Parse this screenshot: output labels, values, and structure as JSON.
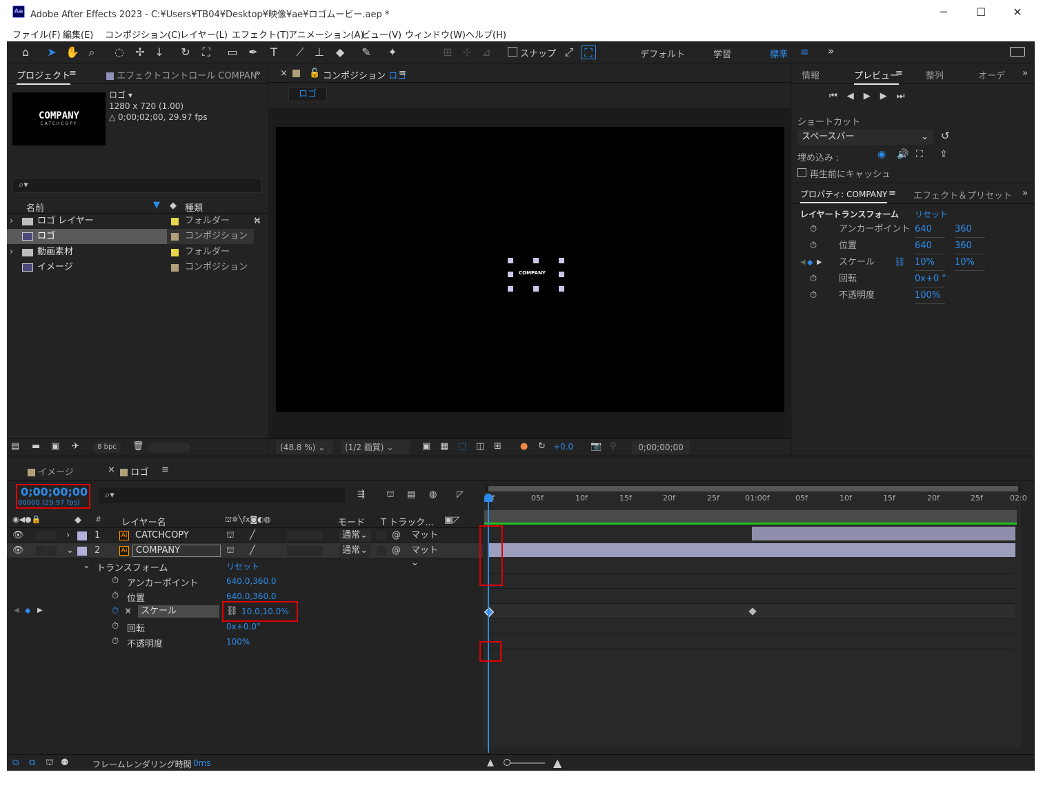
{
  "window": {
    "title": "Adobe After Effects 2023 - C:¥Users¥TB04¥Desktop¥映像¥ae¥ロゴムービー.aep *",
    "app_badge": "Ae",
    "minimize": "─",
    "maximize": "☐",
    "close": "✕"
  },
  "menu": [
    "ファイル(F)",
    "編集(E)",
    "コンポジション(C)",
    "レイヤー(L)",
    "エフェクト(T)",
    "アニメーション(A)",
    "ビュー(V)",
    "ウィンドウ(W)",
    "ヘルプ(H)"
  ],
  "toolbar": {
    "snap_label": "スナップ",
    "workspaces": [
      "デフォルト",
      "学習",
      "標準"
    ],
    "more": "»"
  },
  "project": {
    "tab": "プロジェクト",
    "effects_tab": "エフェクトコントロール COMPAN",
    "more": "»",
    "thumb_title": "COMPANY",
    "thumb_sub": "CATCHCOPY",
    "info_name": "ロゴ ▾",
    "info_size": "1280 x 720 (1.00)",
    "info_dur": "△ 0;00;02;00, 29.97 fps",
    "search_icon": "⌕▾",
    "col_name": "名前",
    "col_type": "種類",
    "items": [
      {
        "name": "ロゴ レイヤー",
        "type": "フォルダー",
        "kind": "folder",
        "color": "#e7d64a",
        "expand": "›"
      },
      {
        "name": "ロゴ",
        "type": "コンポジション",
        "kind": "comp",
        "color": "#b0a07a",
        "expand": ""
      },
      {
        "name": "動画素材",
        "type": "フォルダー",
        "kind": "folder",
        "color": "#e7d64a",
        "expand": "›"
      },
      {
        "name": "イメージ",
        "type": "コンポジション",
        "kind": "comp",
        "color": "#b0a07a",
        "expand": ""
      }
    ],
    "bpc": "8 bpc"
  },
  "comp": {
    "close": "×",
    "tab_prefix": "コンポジション",
    "tab_name": "ロゴ",
    "subtab": "ロゴ",
    "menu": "≡",
    "canvas_text": "COMPANY",
    "zoom": "(48.8 %)",
    "quality": "(1/2 画質)",
    "exposure": "+0.0",
    "timecode": "0;00;00;00"
  },
  "right": {
    "tabs": [
      "情報",
      "プレビュー",
      "整列",
      "オーデ"
    ],
    "more": "»",
    "shortcut_label": "ショートカット",
    "shortcut_value": "スペースバー",
    "embed_label": "埋め込み :",
    "cache_label": "再生前にキャッシュ",
    "props_tab": "プロパティ: COMPANY",
    "effects_presets_tab": "エフェクト＆プリセット",
    "transform_label": "レイヤートランスフォーム",
    "reset": "リセット",
    "props": [
      {
        "name": "アンカーポイント",
        "v1": "640",
        "v2": "360"
      },
      {
        "name": "位置",
        "v1": "640",
        "v2": "360"
      },
      {
        "name": "スケール",
        "v1": "10%",
        "v2": "10%"
      },
      {
        "name": "回転",
        "v1": "0x+0 °",
        "v2": ""
      },
      {
        "name": "不透明度",
        "v1": "100%",
        "v2": ""
      }
    ]
  },
  "timeline": {
    "tabs": [
      "イメージ",
      "ロゴ"
    ],
    "close": "×",
    "menu": "≡",
    "timecode": "0;00;00;00",
    "fps": "00000 (29.97 fps)",
    "col_layer": "レイヤー名",
    "col_mode": "モード",
    "col_track": "T トラック...",
    "ruler": [
      "0f",
      "05f",
      "10f",
      "15f",
      "20f",
      "25f",
      "01:00f",
      "05f",
      "10f",
      "15f",
      "20f",
      "25f",
      "02:0"
    ],
    "layers": [
      {
        "num": "1",
        "name": "CATCHCOPY",
        "color": "#b4b0dc",
        "mode": "通常",
        "matte": "マット"
      },
      {
        "num": "2",
        "name": "COMPANY",
        "color": "#b4b0dc",
        "mode": "通常",
        "matte": "マット"
      }
    ],
    "transform_label": "トランスフォーム",
    "reset": "リセット",
    "props": [
      {
        "name": "アンカーポイント",
        "value": "640.0,360.0"
      },
      {
        "name": "位置",
        "value": "640.0,360.0"
      },
      {
        "name": "スケール",
        "value": "10.0,10.0%"
      },
      {
        "name": "回転",
        "value": "0x+0.0°"
      },
      {
        "name": "不透明度",
        "value": "100%"
      }
    ],
    "render_label": "フレームレンダリング時間",
    "render_value": "0ms"
  }
}
